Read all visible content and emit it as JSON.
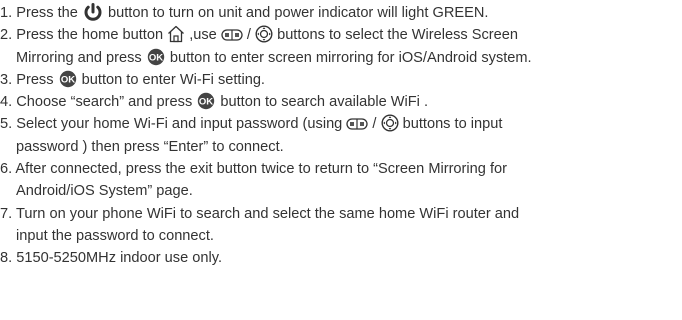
{
  "instructions": {
    "step1": {
      "t1": "1. Press the ",
      "t2": " button to turn on unit and power indicator will light GREEN."
    },
    "step2": {
      "t1": "2. Press the home button ",
      "t2": " ,use ",
      "t3": "/",
      "t4": " buttons to select the Wireless Screen",
      "t5": "Mirroring  and press ",
      "t6": "button to enter screen mirroring for iOS/Android",
      "t7": "system."
    },
    "step3": {
      "t1": "3. Press  ",
      "t2": " button to enter Wi-Fi",
      "t3": "setting."
    },
    "step4": {
      "t1": "4. Choose “search” and press ",
      "t2": " button to search available WiFi ."
    },
    "step5": {
      "t1": "5. Select your home Wi-Fi and input password (using ",
      "t2": "/",
      "t3": " buttons to input",
      "t4": "password ) then press “Enter” to connect."
    },
    "step6": {
      "t1": "6. After connected, press the exit button twice to return to “Screen Mirroring for",
      "t2": "Android/iOS System” page."
    },
    "step7": {
      "t1": "7. Turn on your phone WiFi to search and select the same home WiFi router and",
      "t2": "input the password to connect."
    },
    "step8": {
      "t1": "8. 5150-5250MHz indoor use only."
    }
  },
  "icons": {
    "power": "power-icon",
    "home": "home-icon",
    "channel": "channel-keys-icon",
    "nav": "navigation-ring-icon",
    "ok": "ok-button-icon"
  },
  "colors": {
    "text": "#333333"
  }
}
